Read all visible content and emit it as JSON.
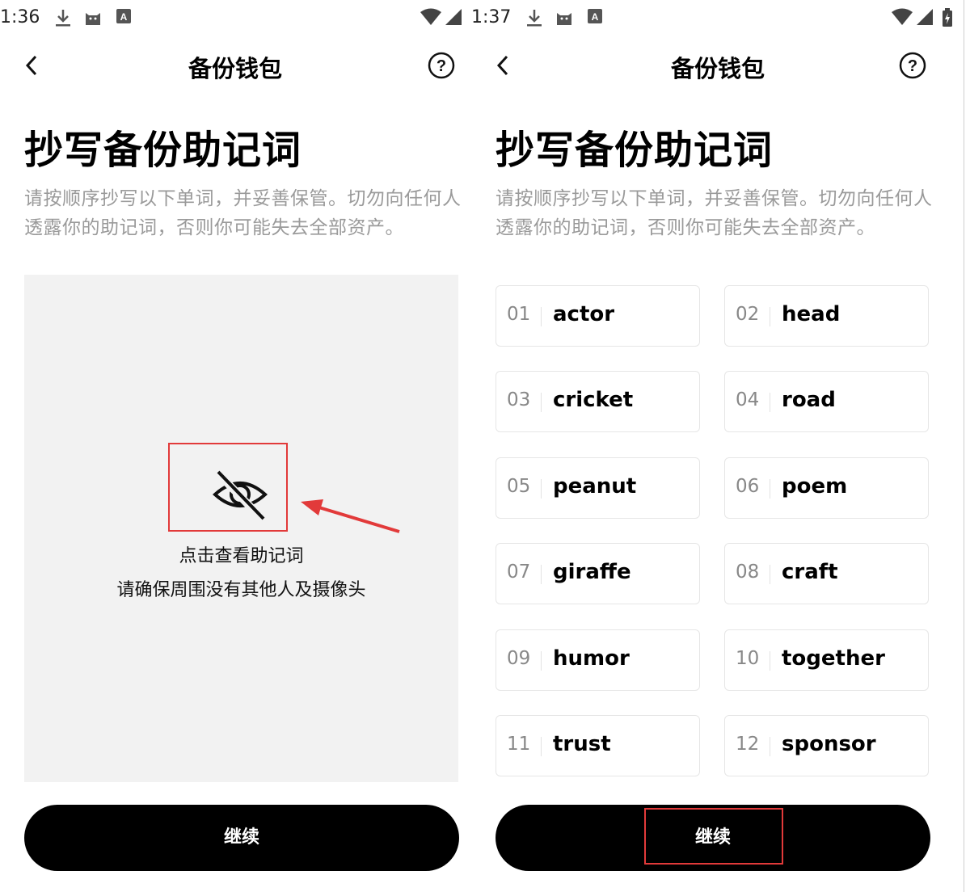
{
  "left": {
    "status": {
      "time": "1:36",
      "icons": [
        "download-icon",
        "cat-icon",
        "a-badge-icon",
        "wifi-icon",
        "signal-icon"
      ]
    },
    "nav": {
      "title": "备份钱包",
      "icons": [
        "back-icon",
        "help-icon"
      ]
    },
    "headline": "抄写备份助记词",
    "description": "请按顺序抄写以下单词，并妥善保管。切勿向任何人透露你的助记词，否则你可能失去全部资产。",
    "reveal": {
      "icon": "eye-off-icon",
      "text": "点击查看助记词",
      "subtext": "请确保周围没有其他人及摄像头",
      "highlight_color": "#e23a3a"
    },
    "continue_label": "继续"
  },
  "right": {
    "status": {
      "time": "1:37",
      "icons": [
        "download-icon",
        "cat-icon",
        "a-badge-icon",
        "wifi-icon",
        "signal-icon",
        "battery-icon"
      ]
    },
    "nav": {
      "title": "备份钱包",
      "icons": [
        "back-icon",
        "help-icon"
      ]
    },
    "headline": "抄写备份助记词",
    "description": "请按顺序抄写以下单词，并妥善保管。切勿向任何人透露你的助记词，否则你可能失去全部资产。",
    "words": [
      {
        "num": "01",
        "word": "actor"
      },
      {
        "num": "02",
        "word": "head"
      },
      {
        "num": "03",
        "word": "cricket"
      },
      {
        "num": "04",
        "word": "road"
      },
      {
        "num": "05",
        "word": "peanut"
      },
      {
        "num": "06",
        "word": "poem"
      },
      {
        "num": "07",
        "word": "giraffe"
      },
      {
        "num": "08",
        "word": "craft"
      },
      {
        "num": "09",
        "word": "humor"
      },
      {
        "num": "10",
        "word": "together"
      },
      {
        "num": "11",
        "word": "trust"
      },
      {
        "num": "12",
        "word": "sponsor"
      }
    ],
    "continue_label": "继续"
  },
  "colors": {
    "button_bg": "#000000",
    "highlight": "#e23a3a",
    "reveal_bg": "#f2f2f2",
    "desc_text": "#9a9a9a"
  }
}
